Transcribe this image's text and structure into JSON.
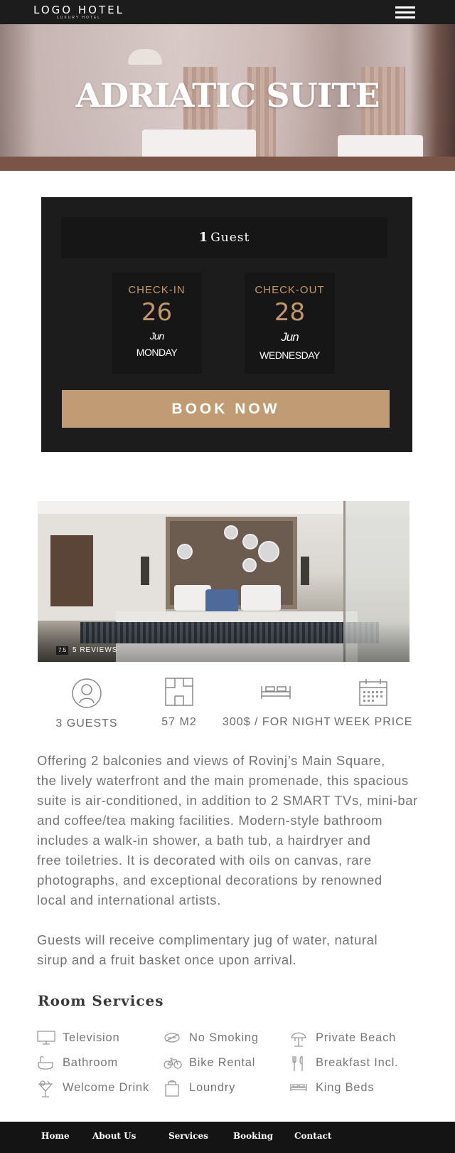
{
  "header": {
    "logo_main": "LOGO HOTEL",
    "logo_sub": "LUXURY HOTEL",
    "menu_icon": "hamburger-menu-icon"
  },
  "hero": {
    "title": "ADRIATIC SUITE"
  },
  "booking": {
    "guests_count": "1",
    "guests_label": "Guest",
    "check_in": {
      "label": "CHECK-IN",
      "day": "26",
      "month": "Jun",
      "weekday": "MONDAY"
    },
    "check_out": {
      "label": "CHECK-OUT",
      "day": "28",
      "month": "Jun",
      "weekday": "WEDNESDAY"
    },
    "book_button": "BOOK NOW"
  },
  "gallery": {
    "review_score": "7.5",
    "review_count": "5 REVIEWS"
  },
  "features": [
    {
      "icon": "user-icon",
      "label": "3 GUESTS"
    },
    {
      "icon": "floor-plan-icon",
      "label": "57 M2"
    },
    {
      "icon": "bed-icon",
      "label": "300$ / FOR NIGHT"
    },
    {
      "icon": "calendar-icon",
      "label": "WEEK PRICE"
    }
  ],
  "description": {
    "paragraph_1": "Offering 2 balconies and views of Rovinj’s Main Square,\nthe lively waterfront and the main promenade, this spacious\nsuite is air-conditioned, in addition to 2 SMART TVs, mini-bar\nand coffee/tea making facilities. Modern-style bathroom\nincludes a walk-in shower, a bath tub, a hairdryer and\nfree toiletries. It is decorated with oils on canvas, rare\nphotographs, and exceptional decorations by renowned\nlocal and international artists.",
    "paragraph_2": "Guests will receive complimentary jug of water, natural\nsirup and a fruit basket once upon arrival."
  },
  "services": {
    "title": "Room Services",
    "items": [
      {
        "icon": "television-icon",
        "label": "Television"
      },
      {
        "icon": "no-smoking-icon",
        "label": "No Smoking"
      },
      {
        "icon": "beach-umbrella-icon",
        "label": "Private Beach"
      },
      {
        "icon": "bathtub-icon",
        "label": "Bathroom"
      },
      {
        "icon": "bicycle-icon",
        "label": "Bike Rental"
      },
      {
        "icon": "fork-knife-icon",
        "label": "Breakfast Incl."
      },
      {
        "icon": "cocktail-icon",
        "label": "Welcome Drink"
      },
      {
        "icon": "laundry-icon",
        "label": "Loundry"
      },
      {
        "icon": "king-bed-icon",
        "label": "King Beds"
      }
    ]
  },
  "footer": {
    "links": [
      "Home",
      "About Us",
      "Services",
      "Booking",
      "Contact"
    ]
  }
}
